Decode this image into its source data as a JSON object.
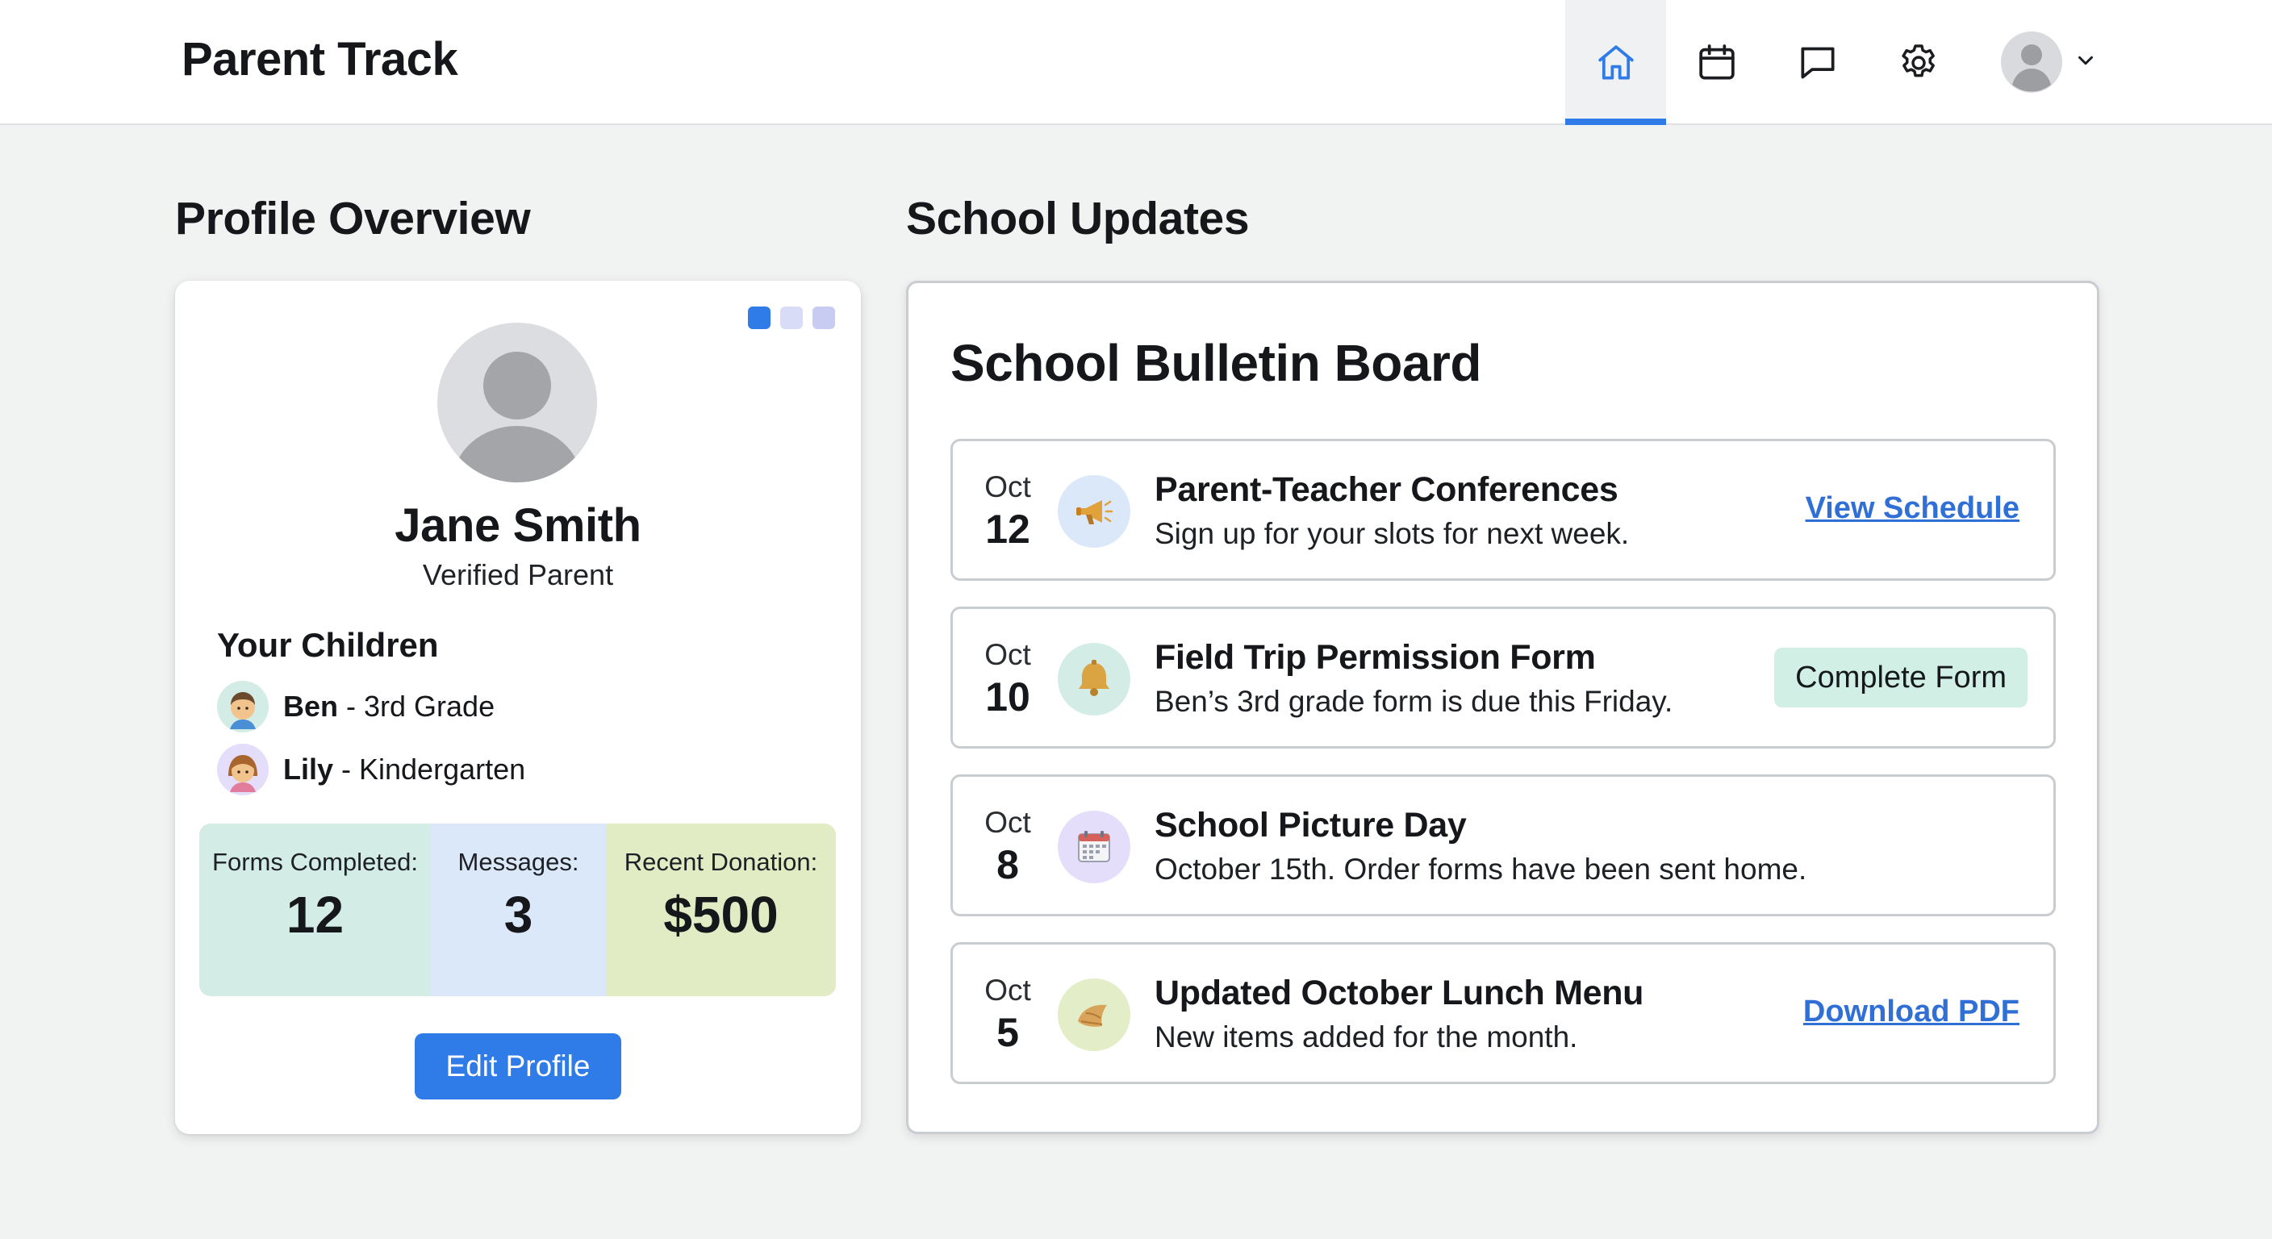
{
  "app": {
    "title": "Parent Track"
  },
  "nav": {
    "items": [
      {
        "icon": "home-icon",
        "active": true
      },
      {
        "icon": "calendar-icon",
        "active": false
      },
      {
        "icon": "chat-icon",
        "active": false
      },
      {
        "icon": "gear-icon",
        "active": false
      }
    ],
    "accent_color": "#2f7be8"
  },
  "profile_section": {
    "heading": "Profile Overview",
    "name": "Jane Smith",
    "role": "Verified Parent",
    "children_heading": "Your Children",
    "children": [
      {
        "name": "Ben",
        "detail": " - 3rd Grade"
      },
      {
        "name": "Lily",
        "detail": " - Kindergarten"
      }
    ],
    "stats": [
      {
        "label": "Forms Completed:",
        "value": "12",
        "color": "#d3ede6"
      },
      {
        "label": "Messages:",
        "value": "3",
        "color": "#dbe8f9"
      },
      {
        "label": "Recent Donation:",
        "value": "$500",
        "color": "#e1ecc4"
      }
    ],
    "edit_label": "Edit Profile",
    "pager_dots": [
      "#2f7be8",
      "#d8dcf6",
      "#c9ccf2"
    ]
  },
  "updates_section": {
    "heading": "School Updates",
    "board_title": "School Bulletin Board",
    "items": [
      {
        "month": "Oct",
        "day": "12",
        "icon": "megaphone-icon",
        "icon_bg": "#dbe8f9",
        "title": "Parent-Teacher Conferences",
        "desc": "Sign up for your slots for next week.",
        "link": "View Schedule"
      },
      {
        "month": "Oct",
        "day": "10",
        "icon": "bell-icon",
        "icon_bg": "#d3ede6",
        "title": "Field Trip Permission Form",
        "desc": "Ben’s 3rd grade form is due this Friday.",
        "action": "Complete Form"
      },
      {
        "month": "Oct",
        "day": "8",
        "icon": "calendar-icon",
        "icon_bg": "#e4defa",
        "title": "School Picture Day",
        "desc": "October 15th. Order forms have been sent home."
      },
      {
        "month": "Oct",
        "day": "5",
        "icon": "food-icon",
        "icon_bg": "#e3edc8",
        "title": "Updated October Lunch Menu",
        "desc": "New items added for the month.",
        "link": "Download PDF"
      }
    ]
  }
}
